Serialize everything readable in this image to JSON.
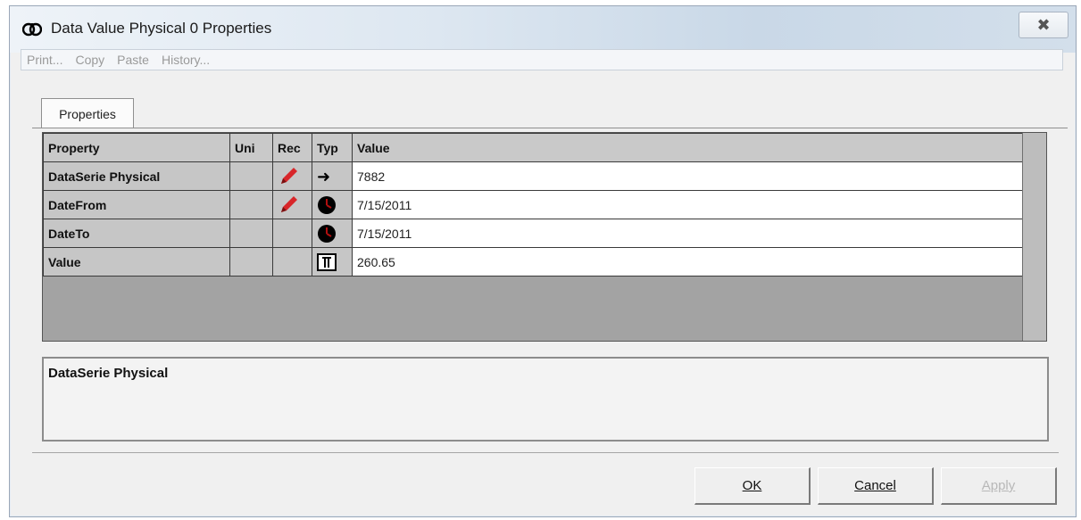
{
  "window": {
    "title": "Data Value Physical 0 Properties",
    "close_glyph": "✖"
  },
  "menu": {
    "items": [
      "Print...",
      "Copy",
      "Paste",
      "History..."
    ]
  },
  "tabs": [
    {
      "label": "Properties"
    }
  ],
  "grid": {
    "headers": {
      "property": "Property",
      "unit": "Uni",
      "rec": "Rec",
      "typ": "Typ",
      "value": "Value"
    },
    "rows": [
      {
        "property": "DataSerie Physical",
        "rec_icon": "pencil-icon",
        "typ_icon": "arrow-right-icon",
        "value": "7882"
      },
      {
        "property": "DateFrom",
        "rec_icon": "pencil-icon",
        "typ_icon": "clock-icon",
        "value": "7/15/2011"
      },
      {
        "property": "DateTo",
        "rec_icon": "",
        "typ_icon": "clock-icon",
        "value": "7/15/2011"
      },
      {
        "property": "Value",
        "rec_icon": "",
        "typ_icon": "number-icon",
        "value": "260.65"
      }
    ]
  },
  "description": {
    "text": "DataSerie Physical"
  },
  "buttons": {
    "ok": "OK",
    "cancel": "Cancel",
    "apply": "Apply"
  },
  "colors": {
    "pencil": "#d8262a",
    "grid_background": "#a3a3a3",
    "disabled_text": "#b8b8b8"
  }
}
